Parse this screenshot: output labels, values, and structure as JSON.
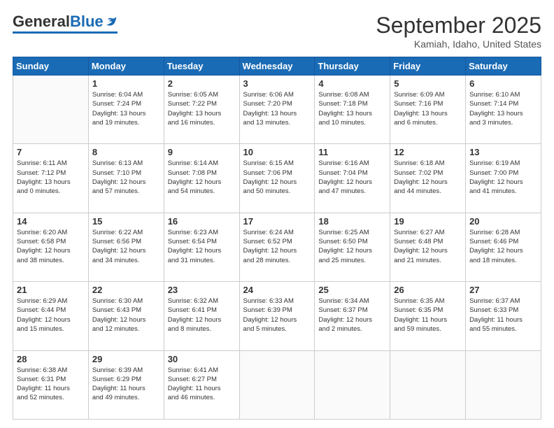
{
  "logo": {
    "general": "General",
    "blue": "Blue"
  },
  "header": {
    "month": "September 2025",
    "location": "Kamiah, Idaho, United States"
  },
  "weekdays": [
    "Sunday",
    "Monday",
    "Tuesday",
    "Wednesday",
    "Thursday",
    "Friday",
    "Saturday"
  ],
  "weeks": [
    [
      {
        "day": "",
        "detail": ""
      },
      {
        "day": "1",
        "detail": "Sunrise: 6:04 AM\nSunset: 7:24 PM\nDaylight: 13 hours\nand 19 minutes."
      },
      {
        "day": "2",
        "detail": "Sunrise: 6:05 AM\nSunset: 7:22 PM\nDaylight: 13 hours\nand 16 minutes."
      },
      {
        "day": "3",
        "detail": "Sunrise: 6:06 AM\nSunset: 7:20 PM\nDaylight: 13 hours\nand 13 minutes."
      },
      {
        "day": "4",
        "detail": "Sunrise: 6:08 AM\nSunset: 7:18 PM\nDaylight: 13 hours\nand 10 minutes."
      },
      {
        "day": "5",
        "detail": "Sunrise: 6:09 AM\nSunset: 7:16 PM\nDaylight: 13 hours\nand 6 minutes."
      },
      {
        "day": "6",
        "detail": "Sunrise: 6:10 AM\nSunset: 7:14 PM\nDaylight: 13 hours\nand 3 minutes."
      }
    ],
    [
      {
        "day": "7",
        "detail": "Sunrise: 6:11 AM\nSunset: 7:12 PM\nDaylight: 13 hours\nand 0 minutes."
      },
      {
        "day": "8",
        "detail": "Sunrise: 6:13 AM\nSunset: 7:10 PM\nDaylight: 12 hours\nand 57 minutes."
      },
      {
        "day": "9",
        "detail": "Sunrise: 6:14 AM\nSunset: 7:08 PM\nDaylight: 12 hours\nand 54 minutes."
      },
      {
        "day": "10",
        "detail": "Sunrise: 6:15 AM\nSunset: 7:06 PM\nDaylight: 12 hours\nand 50 minutes."
      },
      {
        "day": "11",
        "detail": "Sunrise: 6:16 AM\nSunset: 7:04 PM\nDaylight: 12 hours\nand 47 minutes."
      },
      {
        "day": "12",
        "detail": "Sunrise: 6:18 AM\nSunset: 7:02 PM\nDaylight: 12 hours\nand 44 minutes."
      },
      {
        "day": "13",
        "detail": "Sunrise: 6:19 AM\nSunset: 7:00 PM\nDaylight: 12 hours\nand 41 minutes."
      }
    ],
    [
      {
        "day": "14",
        "detail": "Sunrise: 6:20 AM\nSunset: 6:58 PM\nDaylight: 12 hours\nand 38 minutes."
      },
      {
        "day": "15",
        "detail": "Sunrise: 6:22 AM\nSunset: 6:56 PM\nDaylight: 12 hours\nand 34 minutes."
      },
      {
        "day": "16",
        "detail": "Sunrise: 6:23 AM\nSunset: 6:54 PM\nDaylight: 12 hours\nand 31 minutes."
      },
      {
        "day": "17",
        "detail": "Sunrise: 6:24 AM\nSunset: 6:52 PM\nDaylight: 12 hours\nand 28 minutes."
      },
      {
        "day": "18",
        "detail": "Sunrise: 6:25 AM\nSunset: 6:50 PM\nDaylight: 12 hours\nand 25 minutes."
      },
      {
        "day": "19",
        "detail": "Sunrise: 6:27 AM\nSunset: 6:48 PM\nDaylight: 12 hours\nand 21 minutes."
      },
      {
        "day": "20",
        "detail": "Sunrise: 6:28 AM\nSunset: 6:46 PM\nDaylight: 12 hours\nand 18 minutes."
      }
    ],
    [
      {
        "day": "21",
        "detail": "Sunrise: 6:29 AM\nSunset: 6:44 PM\nDaylight: 12 hours\nand 15 minutes."
      },
      {
        "day": "22",
        "detail": "Sunrise: 6:30 AM\nSunset: 6:43 PM\nDaylight: 12 hours\nand 12 minutes."
      },
      {
        "day": "23",
        "detail": "Sunrise: 6:32 AM\nSunset: 6:41 PM\nDaylight: 12 hours\nand 8 minutes."
      },
      {
        "day": "24",
        "detail": "Sunrise: 6:33 AM\nSunset: 6:39 PM\nDaylight: 12 hours\nand 5 minutes."
      },
      {
        "day": "25",
        "detail": "Sunrise: 6:34 AM\nSunset: 6:37 PM\nDaylight: 12 hours\nand 2 minutes."
      },
      {
        "day": "26",
        "detail": "Sunrise: 6:35 AM\nSunset: 6:35 PM\nDaylight: 11 hours\nand 59 minutes."
      },
      {
        "day": "27",
        "detail": "Sunrise: 6:37 AM\nSunset: 6:33 PM\nDaylight: 11 hours\nand 55 minutes."
      }
    ],
    [
      {
        "day": "28",
        "detail": "Sunrise: 6:38 AM\nSunset: 6:31 PM\nDaylight: 11 hours\nand 52 minutes."
      },
      {
        "day": "29",
        "detail": "Sunrise: 6:39 AM\nSunset: 6:29 PM\nDaylight: 11 hours\nand 49 minutes."
      },
      {
        "day": "30",
        "detail": "Sunrise: 6:41 AM\nSunset: 6:27 PM\nDaylight: 11 hours\nand 46 minutes."
      },
      {
        "day": "",
        "detail": ""
      },
      {
        "day": "",
        "detail": ""
      },
      {
        "day": "",
        "detail": ""
      },
      {
        "day": "",
        "detail": ""
      }
    ]
  ]
}
